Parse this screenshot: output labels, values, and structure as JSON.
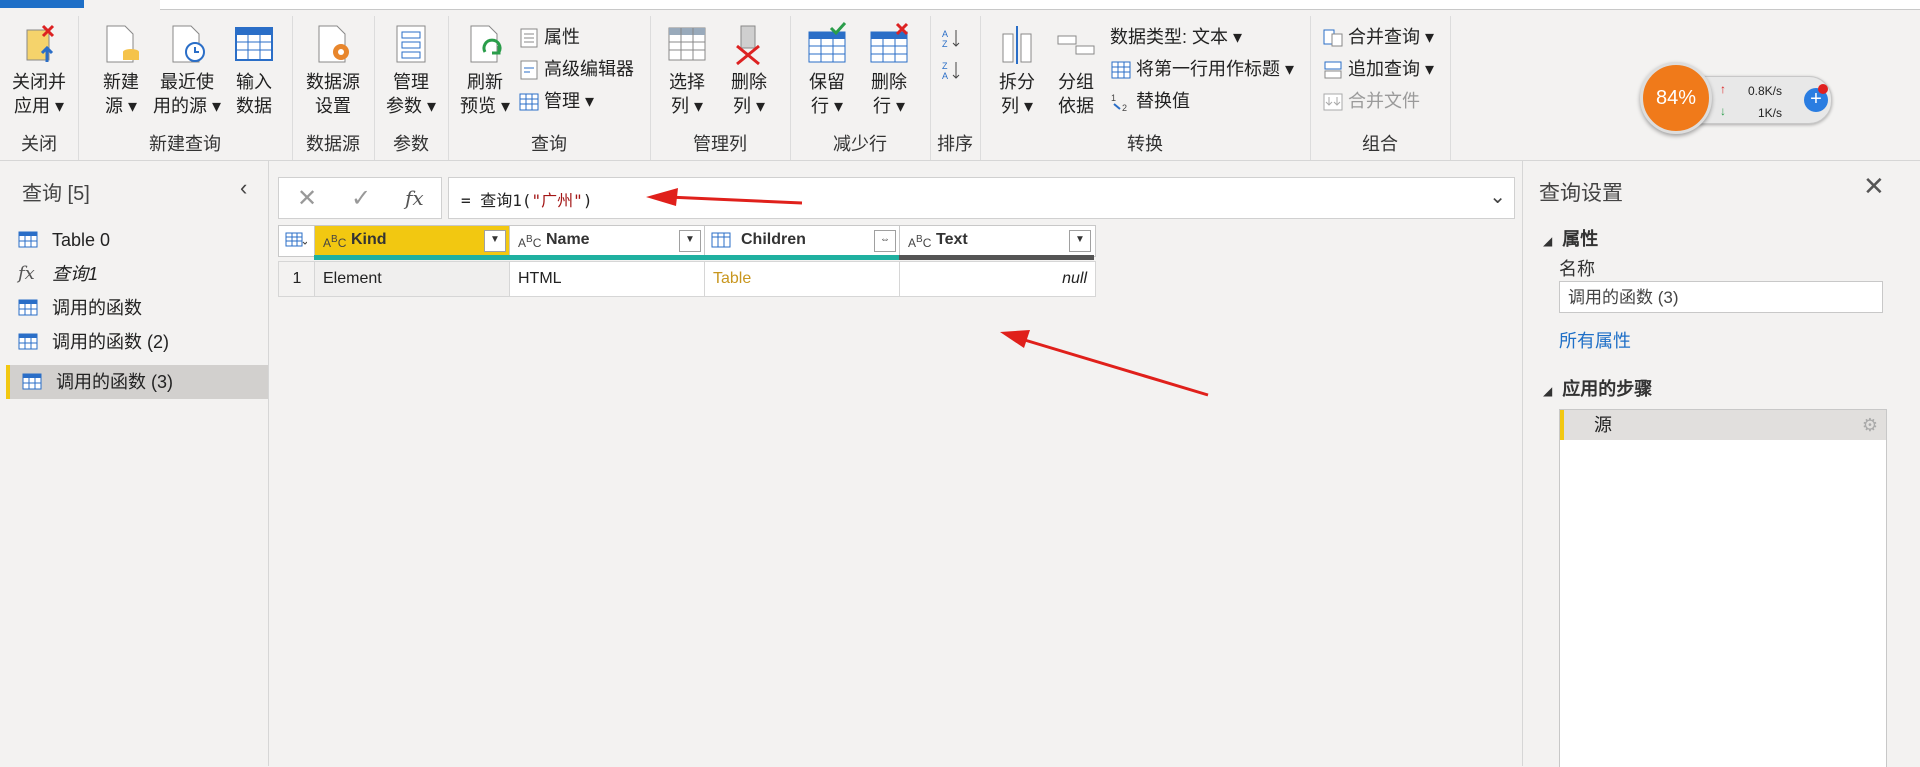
{
  "ribbon": {
    "groups": {
      "close": "关闭",
      "new_query": "新建查询",
      "data_source": "数据源",
      "params": "参数",
      "query": "查询",
      "manage_cols": "管理列",
      "reduce_rows": "减少行",
      "sort": "排序",
      "transform": "转换",
      "combine": "组合"
    },
    "buttons": {
      "close_apply_1": "关闭并",
      "close_apply_2": "应用",
      "new_source_1": "新建",
      "new_source_2": "源",
      "recent_1": "最近使",
      "recent_2": "用的源",
      "enter_data_1": "输入",
      "enter_data_2": "数据",
      "ds_settings_1": "数据源",
      "ds_settings_2": "设置",
      "manage_params_1": "管理",
      "manage_params_2": "参数",
      "refresh_1": "刷新",
      "refresh_2": "预览",
      "properties": "属性",
      "advanced_editor": "高级编辑器",
      "manage": "管理",
      "choose_cols_1": "选择",
      "choose_cols_2": "列",
      "remove_cols_1": "删除",
      "remove_cols_2": "列",
      "keep_rows_1": "保留",
      "keep_rows_2": "行",
      "remove_rows_1": "删除",
      "remove_rows_2": "行",
      "split_1": "拆分",
      "split_2": "列",
      "group_1": "分组",
      "group_2": "依据",
      "data_type": "数据类型: 文本",
      "first_row_header": "将第一行用作标题",
      "replace_values": "替换值",
      "merge_queries": "合并查询",
      "append_queries": "追加查询",
      "combine_files": "合并文件"
    }
  },
  "widget": {
    "percent": "84%",
    "up_speed": "0.8K/s",
    "down_speed": "1K/s"
  },
  "queries": {
    "title": "查询 [5]",
    "items": [
      {
        "label": "Table 0",
        "icon": "table-icon"
      },
      {
        "label": "查询1",
        "icon": "fx-icon"
      },
      {
        "label": "调用的函数",
        "icon": "table-icon"
      },
      {
        "label": "调用的函数 (2)",
        "icon": "table-icon"
      },
      {
        "label": "调用的函数 (3)",
        "icon": "table-icon"
      }
    ]
  },
  "formula": {
    "prefix": "= 查询1(",
    "arg": "\"广州\"",
    "suffix": ")"
  },
  "grid": {
    "columns": [
      {
        "type": "ABC",
        "name": "Kind"
      },
      {
        "type": "ABC",
        "name": "Name"
      },
      {
        "type": "table",
        "name": "Children"
      },
      {
        "type": "ABC",
        "name": "Text"
      }
    ],
    "rows": [
      {
        "num": "1",
        "kind": "Element",
        "name": "HTML",
        "children": "Table",
        "text": "null"
      }
    ]
  },
  "settings": {
    "title": "查询设置",
    "properties_heading": "属性",
    "name_label": "名称",
    "name_value": "调用的函数 (3)",
    "all_properties": "所有属性",
    "steps_heading": "应用的步骤",
    "steps": [
      "源"
    ]
  },
  "colors": {
    "accent_yellow": "#f2c811",
    "quality_teal": "#1fb0a0",
    "annotation_red": "#e0201b",
    "link_blue": "#1e6fc7"
  }
}
